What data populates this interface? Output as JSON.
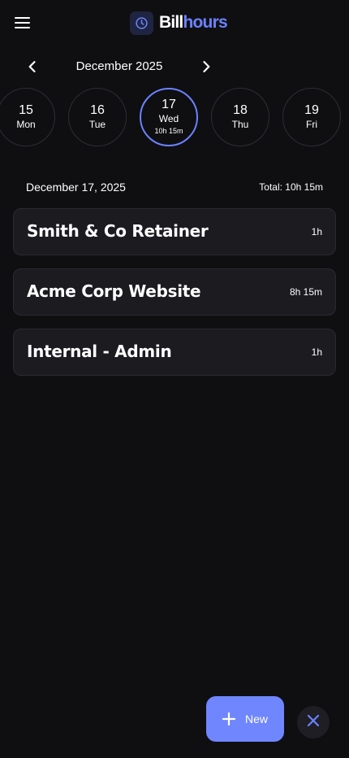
{
  "header": {
    "brand_part1": "Bill",
    "brand_part2": "hours",
    "icons": {
      "menu": "hamburger-menu-icon",
      "logo": "clock-icon"
    }
  },
  "calendar": {
    "month_label": "December 2025",
    "days": [
      {
        "num": "15",
        "dow": "Mon",
        "hours": ""
      },
      {
        "num": "16",
        "dow": "Tue",
        "hours": ""
      },
      {
        "num": "17",
        "dow": "Wed",
        "hours": "10h 15m"
      },
      {
        "num": "18",
        "dow": "Thu",
        "hours": ""
      },
      {
        "num": "19",
        "dow": "Fri",
        "hours": ""
      }
    ],
    "selected_day": "17"
  },
  "summary": {
    "date_heading": "December 17, 2025",
    "total": "Total: 10h 15m"
  },
  "entries": [
    {
      "title": "Smith & Co Retainer",
      "duration": "1h"
    },
    {
      "title": "Acme Corp Website",
      "duration": "8h 15m"
    },
    {
      "title": "Internal - Admin",
      "duration": "1h"
    }
  ],
  "actions": {
    "new_label": "New"
  },
  "colors": {
    "background": "#0f0f12",
    "accent": "#6b82ff",
    "card": "#1b1b20"
  }
}
